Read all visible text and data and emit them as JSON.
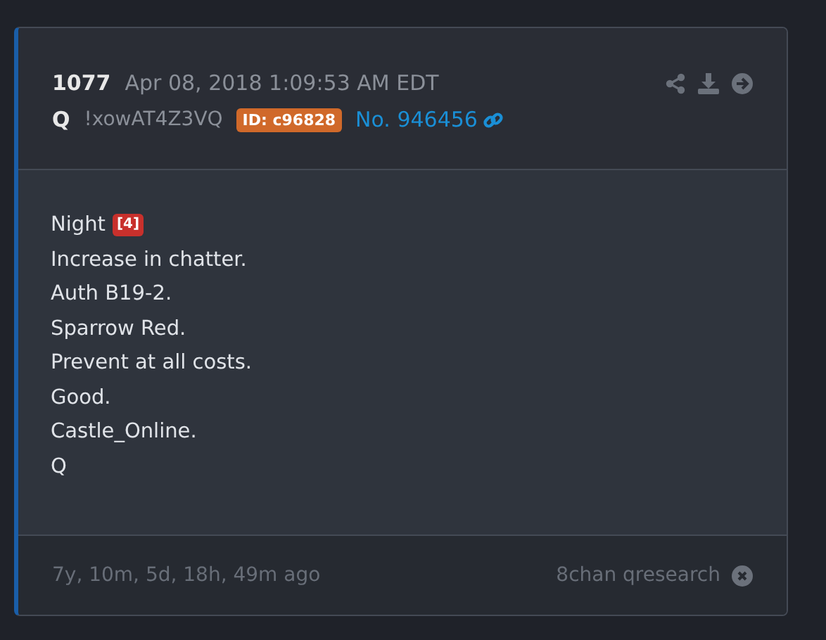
{
  "post": {
    "number": "1077",
    "date": "Apr 08, 2018 1:09:53 AM EDT",
    "author": "Q",
    "tripcode": "!xowAT4Z3VQ",
    "id_badge": "ID: c96828",
    "post_no": "No. 946456",
    "lines": [
      {
        "text": "Night",
        "badge": "[4]"
      },
      {
        "text": "Increase in chatter."
      },
      {
        "text": "Auth B19-2."
      },
      {
        "text": "Sparrow Red."
      },
      {
        "text": "Prevent at all costs."
      },
      {
        "text": "Good."
      },
      {
        "text": "Castle_Online."
      },
      {
        "text": "Q"
      }
    ],
    "age": "7y, 10m, 5d, 18h, 49m ago",
    "source": "8chan qresearch"
  }
}
